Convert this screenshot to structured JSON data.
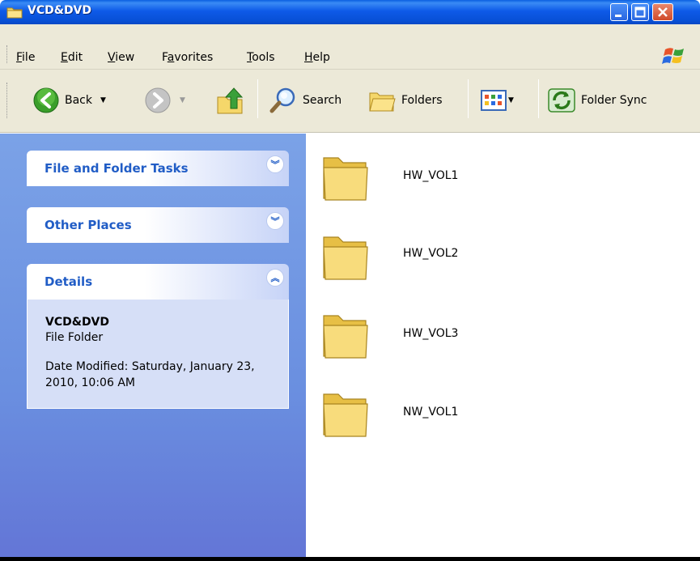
{
  "window": {
    "title": "VCD&DVD",
    "title_icon": "folder-icon",
    "controls": [
      "minimize",
      "maximize",
      "close"
    ]
  },
  "menu": {
    "items": [
      {
        "label": "File",
        "accel": "F"
      },
      {
        "label": "Edit",
        "accel": "E"
      },
      {
        "label": "View",
        "accel": "V"
      },
      {
        "label": "Favorites",
        "accel": "a"
      },
      {
        "label": "Tools",
        "accel": "T"
      },
      {
        "label": "Help",
        "accel": "H"
      }
    ]
  },
  "toolbar": {
    "back_label": "Back",
    "search_label": "Search",
    "folders_label": "Folders",
    "folder_sync_label": "Folder Sync"
  },
  "sidebar": {
    "panels": [
      {
        "title": "File and Folder Tasks",
        "state": "collapsed"
      },
      {
        "title": "Other Places",
        "state": "collapsed"
      },
      {
        "title": "Details",
        "state": "expanded"
      }
    ],
    "details": {
      "name": "VCD&DVD",
      "type": "File Folder",
      "date_modified": "Date Modified: Saturday, January 23, 2010, 10:06 AM"
    }
  },
  "folders": [
    {
      "name": "HW_VOL1"
    },
    {
      "name": "HW_VOL2"
    },
    {
      "name": "HW_VOL3"
    },
    {
      "name": "NW_VOL1"
    }
  ],
  "colors": {
    "titlebar": "#0a5fe0",
    "sidebar_bg": "#6a8fe0",
    "panel_title": "#215dc6",
    "folder_yellow": "#f5d76a"
  }
}
